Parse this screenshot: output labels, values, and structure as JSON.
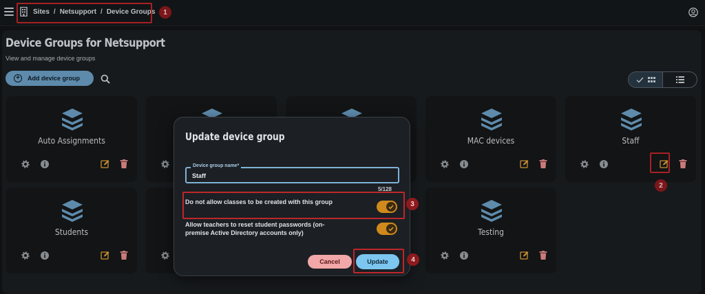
{
  "breadcrumb": {
    "items": [
      "Sites",
      "Netsupport",
      "Device Groups"
    ],
    "separator": "/"
  },
  "header": {
    "title": "Device Groups for Netsupport",
    "subtitle": "View and manage device groups"
  },
  "toolbar": {
    "add_label": "Add device group"
  },
  "cards": [
    {
      "name": "Auto Assignments"
    },
    {
      "name": "MAC devices"
    },
    {
      "name": "Staff"
    },
    {
      "name": "Students"
    },
    {
      "name": "Testing"
    }
  ],
  "dialog": {
    "title": "Update device group",
    "field_label": "Device group name*",
    "field_value": "Staff",
    "counter": "5/128",
    "options": [
      {
        "label": "Do not allow classes to be created with this group",
        "checked": true
      },
      {
        "label": "Allow teachers to reset student passwords (on-premise Active Directory accounts only)",
        "checked": true
      }
    ],
    "cancel_label": "Cancel",
    "update_label": "Update"
  },
  "annotations": [
    "1",
    "2",
    "3",
    "4"
  ],
  "colors": {
    "accent": "#6b9fc4",
    "toggle_on": "#d08a1c",
    "edit": "#e7a53a",
    "delete": "#e88b8b",
    "highlight": "#c0262b"
  }
}
